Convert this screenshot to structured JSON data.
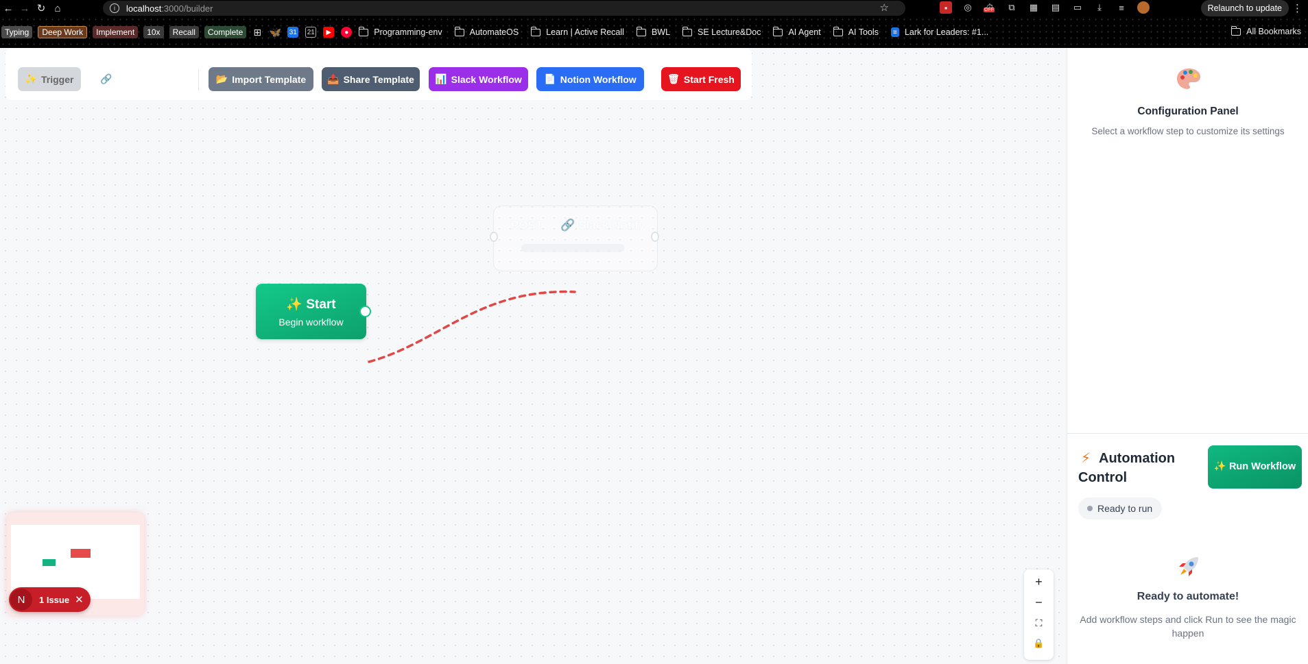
{
  "browser": {
    "url_host": "localhost",
    "url_path": ":3000/builder",
    "relaunch_label": "Relaunch to update",
    "ext_badge": "OFF",
    "bookmark_chips": [
      {
        "label": "Typing",
        "color": "#4a4a4a"
      },
      {
        "label": "Deep Work",
        "color": "#6b3a1c"
      },
      {
        "label": "Implement",
        "color": "#5a2a2a"
      },
      {
        "label": "10x",
        "color": "#3a3a3a"
      },
      {
        "label": "Recall",
        "color": "#3a3a3a"
      },
      {
        "label": "Complete",
        "color": "#2d4a35"
      }
    ],
    "bookmarks": [
      "Programming-env",
      "AutomateOS",
      "Learn | Active Recall",
      "BWL",
      "SE Lecture&Doc",
      "AI Agent",
      "AI Tools"
    ],
    "lark_bookmark": "Lark for Leaders: #1...",
    "all_bookmarks": "All Bookmarks"
  },
  "toolbar": {
    "trigger": "Trigger",
    "import": "Import Template",
    "share": "Share Template",
    "slack": "Slack Workflow",
    "notion": "Notion Workflow",
    "fresh": "Start Fresh"
  },
  "canvas": {
    "start_node": {
      "title": "Start",
      "subtitle": "Begin workflow"
    },
    "ghost_node": {
      "badge": "POST",
      "title": "Slack Notify"
    },
    "issue_count": "1 Issue",
    "issue_avatar": "N"
  },
  "panel": {
    "config_title": "Configuration Panel",
    "config_subtitle": "Select a workflow step to customize its settings",
    "automation_title": "Automation Control",
    "run_button": "Run Workflow",
    "status": "Ready to run",
    "ready_title": "Ready to automate!",
    "ready_subtitle": "Add workflow steps and click Run to see the magic happen"
  },
  "colors": {
    "start_node": "#10b981",
    "edge": "#e04848",
    "run_button": "#0ea06d"
  }
}
